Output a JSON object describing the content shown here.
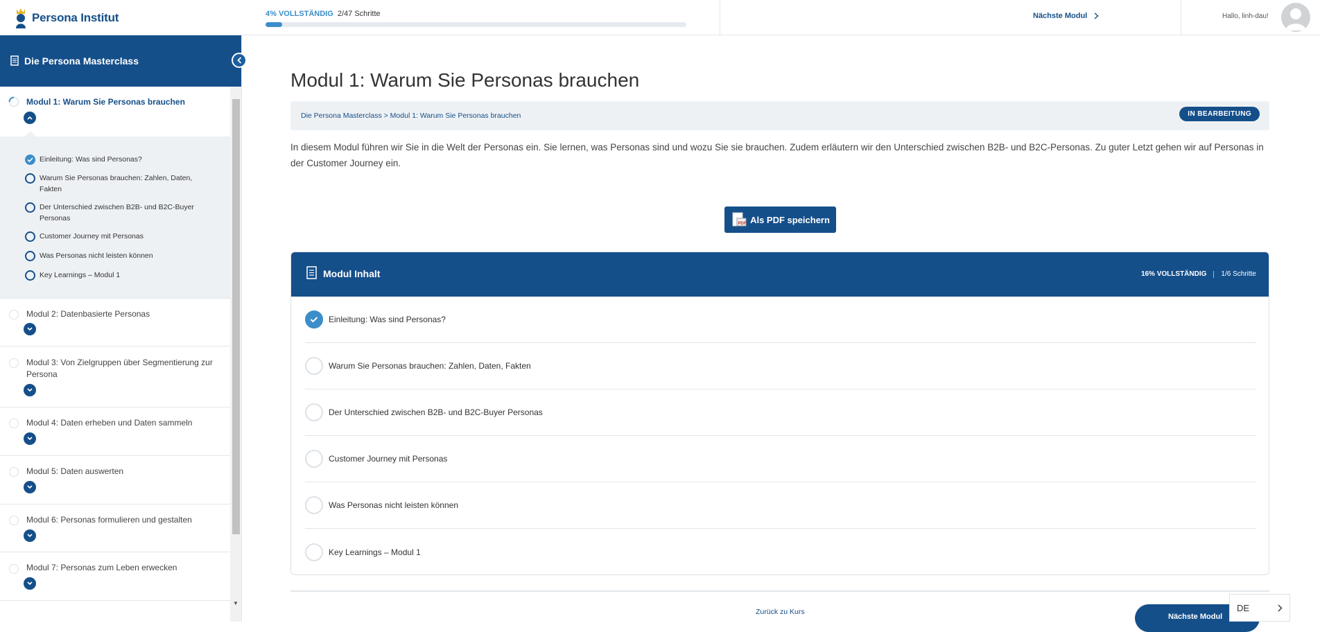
{
  "header": {
    "logo_text": "Persona Institut",
    "progress_pct_label": "4% VOLLSTÄNDIG",
    "progress_steps": "2/47 Schritte",
    "progress_value": 0.04,
    "next_module": "Nächste Modul",
    "greeting": "Hallo, linh-dau!"
  },
  "sidebar": {
    "course_title": "Die Persona Masterclass",
    "active_module": {
      "title": "Modul 1: Warum Sie Personas brauchen",
      "steps": [
        {
          "label": "Einleitung: Was sind Personas?",
          "done": true
        },
        {
          "label": "Warum Sie Personas brauchen: Zahlen, Daten, Fakten",
          "done": false
        },
        {
          "label": "Der Unterschied zwischen B2B- und B2C-Buyer Personas",
          "done": false
        },
        {
          "label": "Customer Journey mit Personas",
          "done": false
        },
        {
          "label": "Was Personas nicht leisten können",
          "done": false
        },
        {
          "label": "Key Learnings – Modul 1",
          "done": false
        }
      ]
    },
    "modules": [
      {
        "title": "Modul 2: Datenbasierte Personas"
      },
      {
        "title": "Modul 3: Von Zielgruppen über Segmentierung zur Persona"
      },
      {
        "title": "Modul 4: Daten erheben und Daten sammeln"
      },
      {
        "title": "Modul 5: Daten auswerten"
      },
      {
        "title": "Modul 6: Personas formulieren und gestalten"
      },
      {
        "title": "Modul 7: Personas zum Leben erwecken"
      }
    ]
  },
  "main": {
    "title": "Modul 1: Warum Sie Personas brauchen",
    "breadcrumb": "Die Persona Masterclass > Modul 1: Warum Sie Personas brauchen",
    "status_badge": "IN BEARBEITUNG",
    "intro": "In diesem Modul führen wir Sie in die Welt der Personas ein. Sie lernen, was Personas sind und wozu Sie sie brauchen. Zudem erläutern wir den Unterschied zwischen B2B- und B2C-Personas. Zu guter Letzt gehen wir auf Personas in der Customer Journey ein.",
    "pdf_button": "Als PDF speichern",
    "content_box": {
      "title": "Modul Inhalt",
      "pct_label": "16% VOLLSTÄNDIG",
      "steps_label": "1/6 Schritte",
      "rows": [
        {
          "label": "Einleitung: Was sind Personas?",
          "done": true
        },
        {
          "label": "Warum Sie Personas brauchen: Zahlen, Daten, Fakten",
          "done": false
        },
        {
          "label": "Der Unterschied zwischen B2B- und B2C-Buyer Personas",
          "done": false
        },
        {
          "label": "Customer Journey mit Personas",
          "done": false
        },
        {
          "label": "Was Personas nicht leisten können",
          "done": false
        },
        {
          "label": "Key Learnings – Modul 1",
          "done": false
        }
      ]
    },
    "back_link": "Zurück zu Kurs",
    "next_button": "Nächste Modul"
  },
  "language": "DE",
  "colors": {
    "brand": "#154f8a",
    "accent": "#3b8ec9"
  }
}
